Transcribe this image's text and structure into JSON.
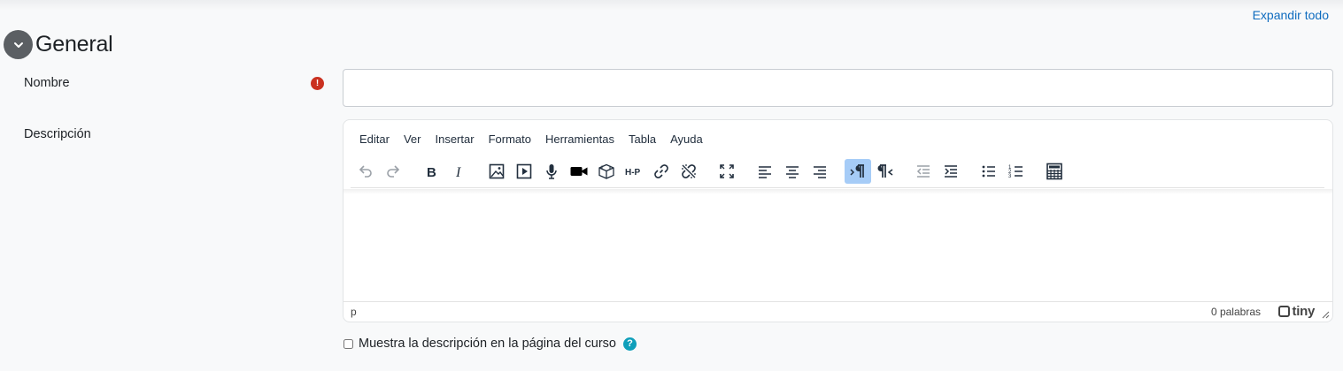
{
  "header": {
    "expand_all": "Expandir todo",
    "section_title": "General"
  },
  "fields": {
    "name": {
      "label": "Nombre",
      "value": "",
      "required_icon": "exclamation-icon"
    },
    "description": {
      "label": "Descripción"
    }
  },
  "editor": {
    "menu": [
      "Editar",
      "Ver",
      "Insertar",
      "Formato",
      "Herramientas",
      "Tabla",
      "Ayuda"
    ],
    "toolbar_icons": [
      "undo-icon",
      "redo-icon",
      "bold-icon",
      "italic-icon",
      "image-icon",
      "media-icon",
      "record-audio-icon",
      "record-video-icon",
      "content-bank-icon",
      "h5p-icon",
      "link-icon",
      "unlink-icon",
      "fullscreen-icon",
      "align-left-icon",
      "align-center-icon",
      "align-right-icon",
      "ltr-icon",
      "rtl-icon",
      "outdent-icon",
      "indent-icon",
      "bullet-list-icon",
      "numbered-list-icon",
      "equation-icon"
    ],
    "status_path": "p",
    "word_count": "0 palabras",
    "brand": "tiny"
  },
  "show_description": {
    "label": "Muestra la descripción en la página del curso",
    "checked": false
  },
  "colors": {
    "link": "#0f6cbf",
    "required": "#ca3120",
    "help": "#0f9fba",
    "active_button": "#a6ccf7"
  }
}
